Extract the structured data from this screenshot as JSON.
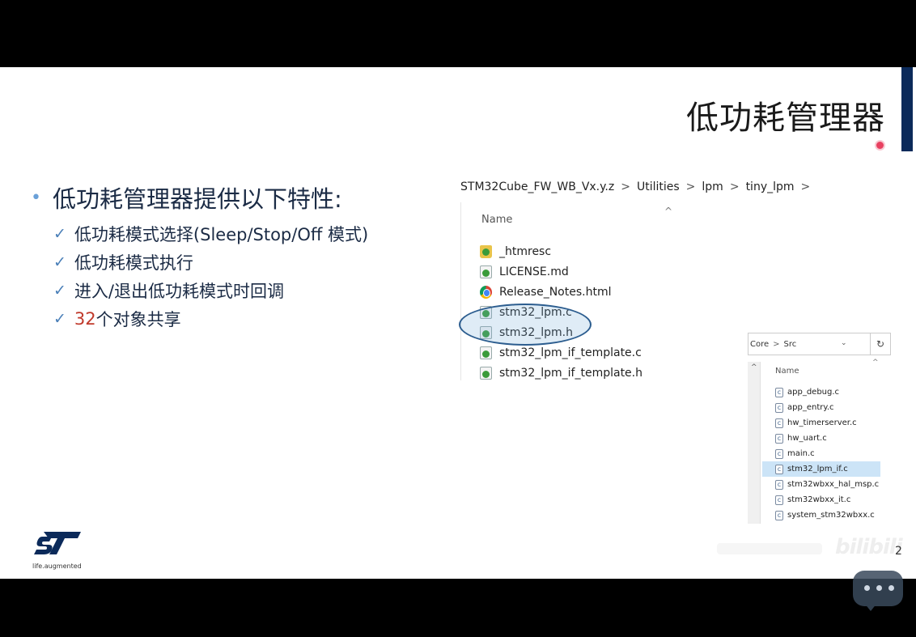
{
  "slide": {
    "title": "低功耗管理器",
    "bullet_main": "低功耗管理器提供以下特性:",
    "sub_items": [
      {
        "text": "低功耗模式选择(Sleep/Stop/Off 模式)"
      },
      {
        "text": "低功耗模式执行"
      },
      {
        "text": "进入/退出低功耗模式时回调"
      },
      {
        "prefix": "32",
        "text": "个对象共享"
      }
    ],
    "page_number": "2"
  },
  "explorer_main": {
    "breadcrumb": [
      "STM32Cube_FW_WB_Vx.y.z",
      "Utilities",
      "lpm",
      "tiny_lpm"
    ],
    "breadcrumb_sep": ">",
    "column_header": "Name",
    "files": [
      {
        "name": "_htmresc",
        "icon": "folder-icon"
      },
      {
        "name": "LICENSE.md",
        "icon": "document-icon"
      },
      {
        "name": "Release_Notes.html",
        "icon": "chrome-icon"
      },
      {
        "name": "stm32_lpm.c",
        "icon": "document-icon"
      },
      {
        "name": "stm32_lpm.h",
        "icon": "document-icon"
      },
      {
        "name": "stm32_lpm_if_template.c",
        "icon": "document-icon"
      },
      {
        "name": "stm32_lpm_if_template.h",
        "icon": "document-icon"
      }
    ]
  },
  "explorer_small": {
    "path": [
      "Core",
      "Src"
    ],
    "column_header": "Name",
    "files": [
      {
        "name": "app_debug.c",
        "selected": false
      },
      {
        "name": "app_entry.c",
        "selected": false
      },
      {
        "name": "hw_timerserver.c",
        "selected": false
      },
      {
        "name": "hw_uart.c",
        "selected": false
      },
      {
        "name": "main.c",
        "selected": false
      },
      {
        "name": "stm32_lpm_if.c",
        "selected": true
      },
      {
        "name": "stm32wbxx_hal_msp.c",
        "selected": false
      },
      {
        "name": "stm32wbxx_it.c",
        "selected": false
      },
      {
        "name": "system_stm32wbxx.c",
        "selected": false
      }
    ]
  },
  "logo": {
    "tagline": "life.augmented"
  },
  "watermark": {
    "text": "bilibili"
  },
  "icons": {
    "check": "✓",
    "bullet": "•",
    "chevron": ">",
    "refresh": "↻",
    "caret_up": "^",
    "dropdown": "⌄"
  },
  "colors": {
    "accent_navy": "#0b2a5a",
    "highlight_red": "#c0392b",
    "selection_blue": "#cce4f7"
  }
}
